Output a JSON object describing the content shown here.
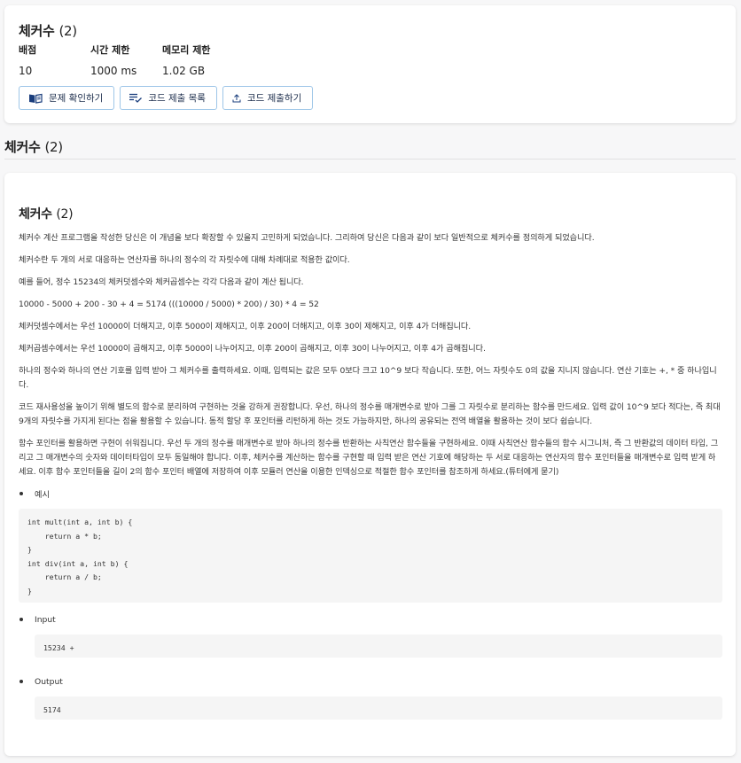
{
  "header": {
    "title": "체커수",
    "count": "(2)",
    "meta": [
      {
        "key": "배점",
        "value": "10"
      },
      {
        "key": "시간 제한",
        "value": "1000 ms"
      },
      {
        "key": "메모리 제한",
        "value": "1.02 GB"
      }
    ],
    "buttons": {
      "check_problem": "문제 확인하기",
      "submission_list": "코드 제출 목록",
      "submit_code": "코드 제출하기"
    }
  },
  "section": {
    "title": "체커수",
    "count": "(2)"
  },
  "problem": {
    "title": "체커수",
    "count": "(2)",
    "paragraphs": [
      "체커수 계산 프로그램을 작성한 당신은 이 개념을 보다 확장할 수 있을지 고민하게 되었습니다. 그리하여 당신은 다음과 같이 보다 일반적으로 체커수를 정의하게 되었습니다.",
      "체커수란 두 개의 서로 대응하는 연산자를 하나의 정수의 각 자릿수에 대해 차례대로 적용한 값이다.",
      "예를 들어, 정수 15234의 체커덧셈수와 체커곱셈수는 각각 다음과 같이 계산 됩니다.",
      "10000 - 5000 + 200 - 30 + 4 = 5174 (((10000 / 5000) * 200) / 30) * 4 = 52",
      "체커덧셈수에서는 우선 10000이 더해지고, 이후 5000이 제해지고, 이후 200이 더해지고, 이후 30이 제해지고, 이후 4가 더해집니다.",
      "체커곱셈수에서는 우선 10000이 곱해지고, 이후 5000이 나누어지고, 이후 200이 곱해지고, 이후 30이 나누어지고, 이후 4가 곱해집니다.",
      "하나의 정수와 하나의 연산 기호를 입력 받아 그 체커수를 출력하세요. 이때, 입력되는 값은 모두 0보다 크고 10^9 보다 작습니다. 또한, 어느 자릿수도 0의 값을 지니지 않습니다. 연산 기호는 +, * 중 하나입니다.",
      "코드 재사용성을 높이기 위해 별도의 함수로 분리하여 구현하는 것을 강하게 권장합니다. 우선, 하나의 정수를 매개변수로 받아 그를 그 자릿수로 분리하는 함수를 만드세요. 입력 값이 10^9 보다 적다는, 즉 최대 9개의 자릿수를 가지게 된다는 점을 활용할 수 있습니다. 동적 할당 후 포인터를 리턴하게 하는 것도 가능하지만, 하나의 공유되는 전역 배열을 활용하는 것이 보다 쉽습니다.",
      "함수 포인터를 활용하면 구현이 쉬워집니다. 우선 두 개의 정수를 매개변수로 받아 하나의 정수를 반환하는 사칙연산 함수들을 구현하세요. 이때 사칙연산 함수들의 함수 시그니처, 즉 그 반환값의 데이터 타입, 그리고 그 매개변수의 숫자와 데이터타입이 모두 동일해야 합니다. 이후, 체커수를 계산하는 함수를 구현할 때 입력 받은 연산 기호에 해당하는 두 서로 대응하는 연산자의 함수 포인터들을 매개변수로 입력 받게 하세요. 이후 함수 포인터들을 길이 2의 함수 포인터 배열에 저장하여 이후 모듈러 연산을 이용한 인덱싱으로 적절한 함수 포인터를 참조하게 하세요.(튜터에게 묻기)"
    ],
    "example_label": "예시",
    "example_code": "int mult(int a, int b) {\n    return a * b;\n}\nint div(int a, int b) {\n    return a / b;\n}",
    "input_label": "Input",
    "input_value": "15234 +",
    "output_label": "Output",
    "output_value": "5174"
  }
}
